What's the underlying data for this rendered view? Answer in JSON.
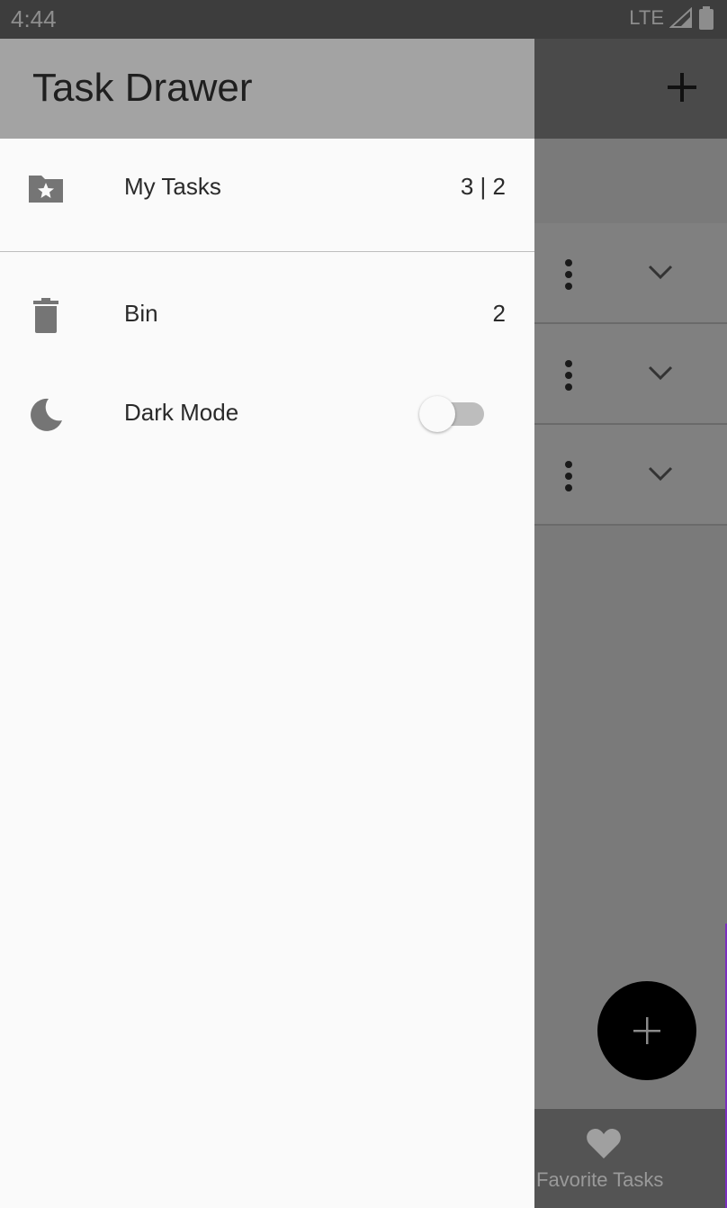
{
  "status_bar": {
    "time": "4:44",
    "network": "LTE"
  },
  "drawer": {
    "title": "Task Drawer",
    "items": [
      {
        "label": "My Tasks",
        "count": "3 | 2",
        "icon": "folder-star-icon"
      },
      {
        "label": "Bin",
        "count": "2",
        "icon": "trash-icon"
      },
      {
        "label": "Dark Mode",
        "icon": "moon-icon",
        "toggle_on": false
      }
    ]
  },
  "background": {
    "bottom_nav_label": "Favorite Tasks",
    "fab_icon": "plus-icon"
  },
  "colors": {
    "drawer_header": "#a3a3a3",
    "fab": "#000000",
    "scrim": "#7a7a7a"
  }
}
